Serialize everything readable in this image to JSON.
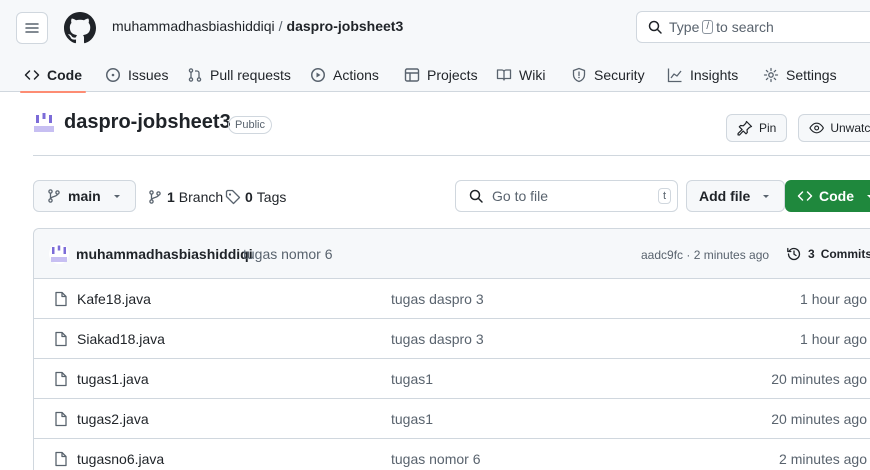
{
  "header": {
    "owner": "muhammadhasbiashiddiqi",
    "separator": "/",
    "repo": "daspro-jobsheet3",
    "search_prefix": "Type",
    "search_key": "/",
    "search_suffix": "to search"
  },
  "tabs": [
    {
      "label": "Code",
      "icon": "code-icon",
      "active": true
    },
    {
      "label": "Issues",
      "icon": "issue-icon"
    },
    {
      "label": "Pull requests",
      "icon": "pull-request-icon"
    },
    {
      "label": "Actions",
      "icon": "play-icon"
    },
    {
      "label": "Projects",
      "icon": "table-icon"
    },
    {
      "label": "Wiki",
      "icon": "book-icon"
    },
    {
      "label": "Security",
      "icon": "shield-icon"
    },
    {
      "label": "Insights",
      "icon": "graph-icon"
    },
    {
      "label": "Settings",
      "icon": "gear-icon"
    }
  ],
  "repo_header": {
    "name": "daspro-jobsheet3",
    "visibility": "Public",
    "pin_label": "Pin",
    "watch_label": "Unwatch"
  },
  "controls": {
    "branch": "main",
    "branch_count": "1",
    "branch_word": "Branch",
    "tag_count": "0",
    "tag_word": "Tags",
    "goto_placeholder": "Go to file",
    "goto_key": "t",
    "add_file_label": "Add file",
    "code_label": "Code"
  },
  "latest_commit": {
    "author": "muhammadhasbiashiddiqi",
    "message": "tugas nomor 6",
    "hash_time": "aadc9fc · 2 minutes ago",
    "commits_count": "3",
    "commits_word": "Commits"
  },
  "files": [
    {
      "name": "Kafe18.java",
      "message": "tugas daspro 3",
      "time": "1 hour ago"
    },
    {
      "name": "Siakad18.java",
      "message": "tugas daspro 3",
      "time": "1 hour ago"
    },
    {
      "name": "tugas1.java",
      "message": "tugas1",
      "time": "20 minutes ago"
    },
    {
      "name": "tugas2.java",
      "message": "tugas1",
      "time": "20 minutes ago"
    },
    {
      "name": "tugasno6.java",
      "message": "tugas nomor 6",
      "time": "2 minutes ago"
    }
  ],
  "colors": {
    "accent_green": "#1f883d",
    "tab_underline": "#fd8c73",
    "border": "#d0d7de",
    "muted": "#59636e"
  }
}
